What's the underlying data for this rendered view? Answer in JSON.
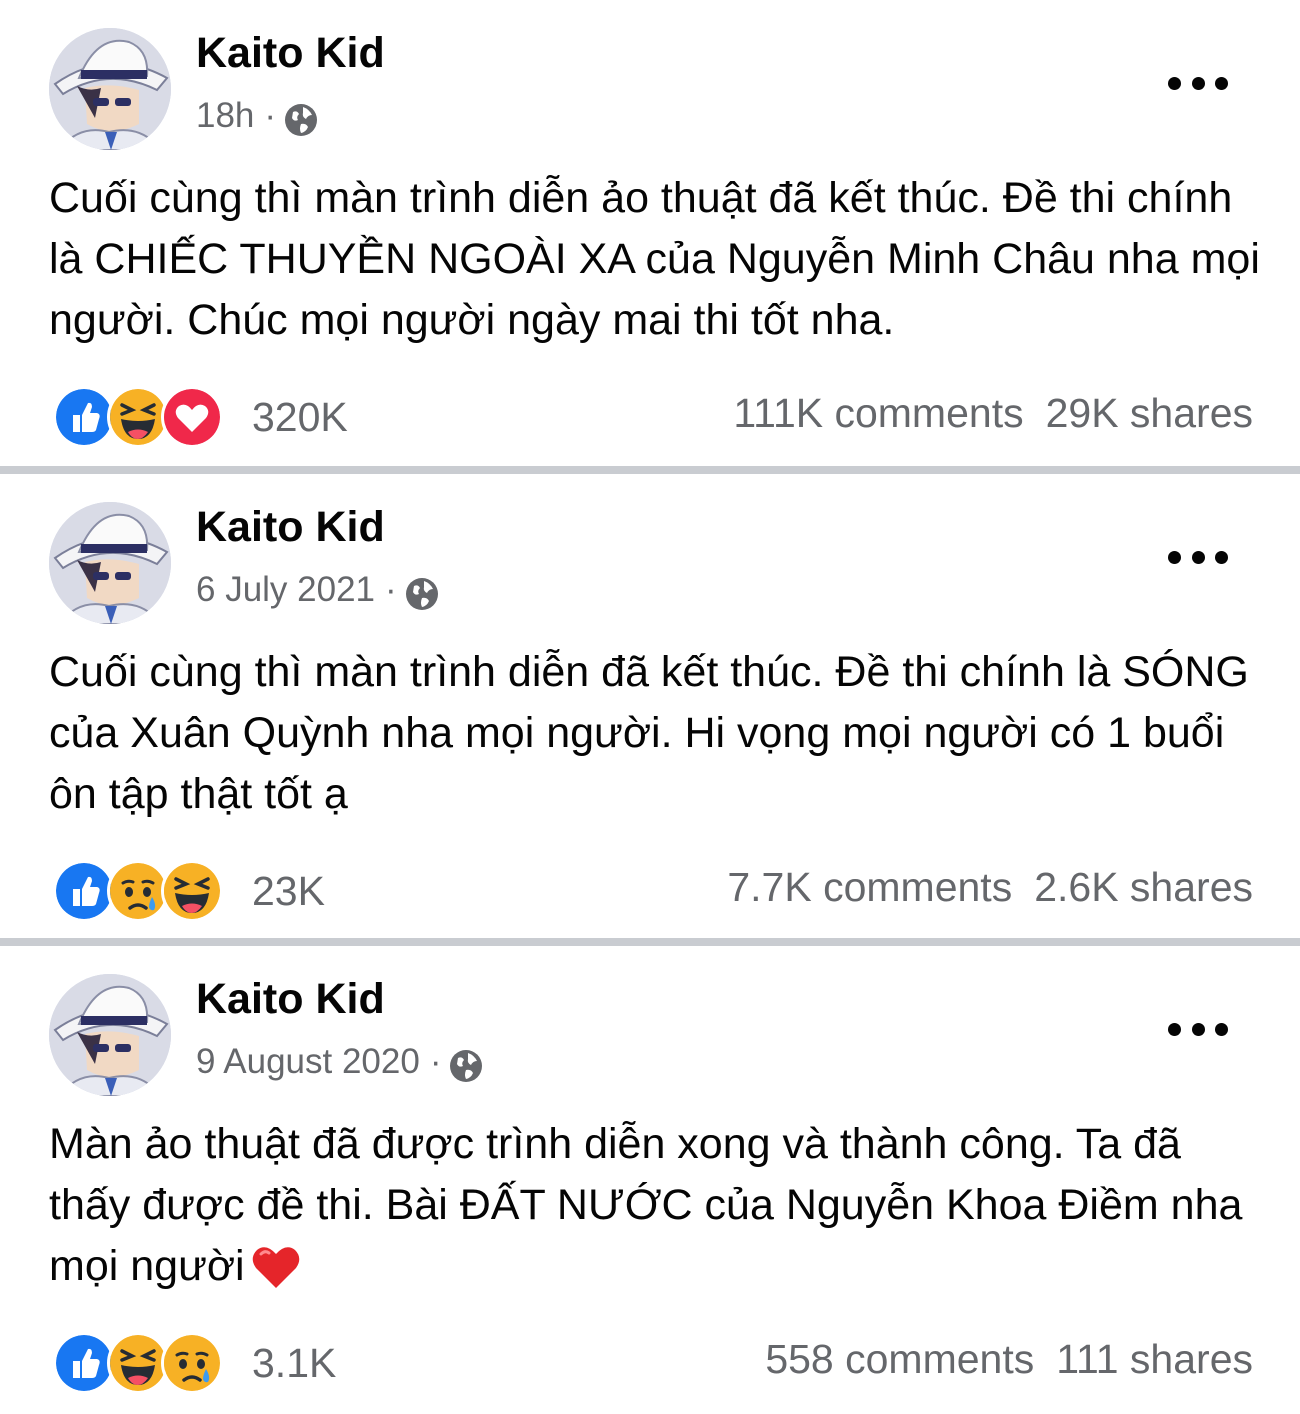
{
  "posts": [
    {
      "author": "Kaito Kid",
      "time": "18h",
      "separator": "·",
      "privacy_icon": "globe-icon",
      "text": "Cuối cùng thì màn trình diễn ảo thuật đã kết thúc. Đề thi chính là CHIẾC THUYỀN NGOÀI XA của Nguyễn Minh Châu nha mọi người. Chúc mọi người ngày mai thi tốt nha.",
      "reactions": [
        "like",
        "haha",
        "love"
      ],
      "reaction_count": "320K",
      "comments": "111K comments",
      "shares": "29K shares"
    },
    {
      "author": "Kaito Kid",
      "time": "6 July 2021",
      "separator": "·",
      "privacy_icon": "globe-icon",
      "text": "Cuối cùng thì màn trình diễn đã kết thúc. Đề thi chính là SÓNG của Xuân Quỳnh nha mọi người. Hi vọng mọi người có 1 buổi ôn tập thật tốt ạ",
      "reactions": [
        "like",
        "sad",
        "haha"
      ],
      "reaction_count": "23K",
      "comments": "7.7K comments",
      "shares": "2.6K shares"
    },
    {
      "author": "Kaito Kid",
      "time": "9 August 2020",
      "separator": "·",
      "privacy_icon": "globe-icon",
      "text": "Màn ảo thuật đã được trình diễn xong và thành công. Ta đã thấy được đề thi. Bài ĐẤT NƯỚC của Nguyễn Khoa Điềm nha mọi người",
      "text_emoji": "red-heart-emoji",
      "reactions": [
        "like",
        "haha",
        "sad"
      ],
      "reaction_count": "3.1K",
      "comments": "558 comments",
      "shares": "111 shares"
    }
  ],
  "colors": {
    "like_blue": "#1877f2",
    "love_red": "#f0284a",
    "emoji_yellow": "#f7b125",
    "secondary_text": "#65676b",
    "divider": "#c9ccd1"
  }
}
